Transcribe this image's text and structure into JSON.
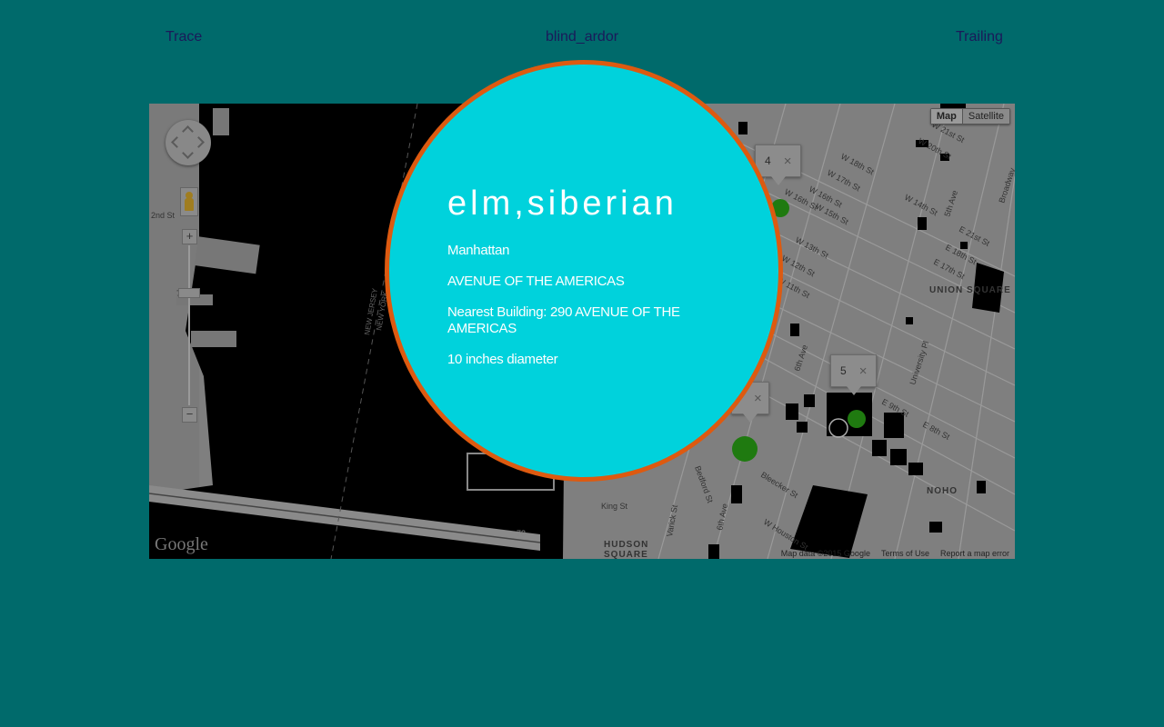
{
  "nav": {
    "left": "Trace",
    "center": "blind_ardor",
    "right": "Trailing"
  },
  "map": {
    "type_buttons": {
      "map": "Map",
      "satellite": "Satellite"
    },
    "zoom_in": "+",
    "zoom_out": "−",
    "logo": "Google",
    "footer": {
      "data": "Map data ©2015 Google",
      "terms": "Terms of Use",
      "report": "Report a map error"
    },
    "labels": {
      "w21": "W 21st St",
      "w20": "W 20th St",
      "w18": "W 18th St",
      "w17": "W 17th St",
      "w16a": "W 16th St",
      "w16b": "W 16th St",
      "w15": "W 15th St",
      "w14": "W 14th St",
      "w13": "W 13th St",
      "w12": "W 12th St",
      "w11": "W 11th St",
      "e21": "E 21st St",
      "e18": "E 18th St",
      "e17": "E 17th St",
      "e9": "E 9th St",
      "e8": "E 8th St",
      "fifth_ave": "5th Ave",
      "sixth_ave_a": "6th Ave",
      "sixth_ave_b": "6th Ave",
      "broadway": "Broadway",
      "union_square": "UNION SQUARE",
      "university_pl": "University Pl",
      "noho": "NOHO",
      "hudson_square_1": "HUDSON",
      "hudson_square_2": "SQUARE",
      "king_st": "King St",
      "varick_st": "Varick St",
      "bedford_st": "Bedford St",
      "bleecker_st": "Bleecker St",
      "w_houston": "W Houston St",
      "nj_1": "NEW JERSEY",
      "nj_2": "NEW YORK",
      "hwy": "78",
      "st_2nd": "2nd St",
      "west_7": "7"
    },
    "infowindows": [
      {
        "label": "4",
        "close": "×"
      },
      {
        "label": "5",
        "close": "×"
      },
      {
        "label": "",
        "close": "×"
      }
    ],
    "marker_color": "#1f7a10"
  },
  "popup": {
    "title": "elm,siberian",
    "borough": "Manhattan",
    "street": "AVENUE OF THE AMERICAS",
    "nearest_building": "Nearest Building: 290 AVENUE OF THE AMERICAS",
    "diameter": "10 inches diameter",
    "fill_color": "#00d2dc",
    "border_color": "#dd5a10"
  },
  "colors": {
    "background": "#006a6b",
    "nav_text": "#1a1a5a",
    "water": "#000000",
    "land": "#7f7f7f"
  }
}
